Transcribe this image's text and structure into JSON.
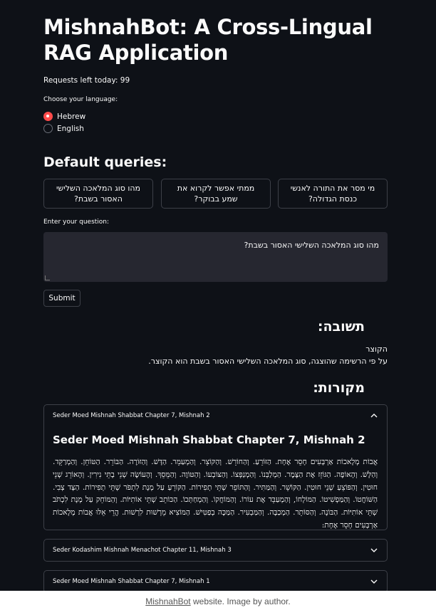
{
  "app": {
    "title": "MishnahBot: A Cross-Lingual RAG Application",
    "requests_left": "Requests left today: 99",
    "language": {
      "label": "Choose your language:",
      "options": [
        "Hebrew",
        "English"
      ],
      "selected": "Hebrew"
    },
    "default_queries": {
      "heading": "Default queries:",
      "buttons": [
        "מהו סוג המלאכה השלישי האסור בשבת?",
        "ממתי אפשר לקרוא את שמע בבוקר?",
        "מי מסר את התורה לאנשי כנסת הגדולה?"
      ]
    },
    "question": {
      "label": "Enter your question:",
      "value": "מהו סוג המלאכה השלישי האסור בשבת?"
    },
    "submit_label": "Submit",
    "answer": {
      "heading": "תשובה:",
      "line1": "הקוצר",
      "line2": "על פי הרשימה שהוצגה, סוג המלאכה השלישי האסור בשבת הוא הקוצר."
    },
    "sources": {
      "heading": "מקורות:",
      "items": [
        {
          "label": "Seder Moed Mishnah Shabbat Chapter 7, Mishnah 2",
          "expanded": true,
          "title": "Seder Moed Mishnah Shabbat Chapter 7, Mishnah 2",
          "text": "אֲבוֹת מְלָאכוֹת אַרְבָּעִים חָסֵר אֶחָת. הַזּוֹרֵעַ. וְהַחוֹרֵשׁ. וְהַקּוֹצֵר. וְהַמְעַמֵּר. הַדָּשׁ. וְהַזּוֹרֶה. הַבּוֹרֵר. הַטּוֹחֵן. וְהַמְרַקֵּד. וְהַלָּשׁ. וְהָאוֹפֶה. הַגּוֹזֵז אֶת הַצֶּמֶר. הַמְלַבְּנוֹ. וְהַמְנַפְּצוֹ. וְהַצּוֹבְעוֹ. וְהַטּוֹוֶה. וְהַמֵּסֵךְ. וְהָעוֹשֶׂה שְׁנֵי בָתֵּי נִירִין. וְהָאוֹרֵג שְׁנֵי חוּטִין. וְהַפּוֹצֵעַ שְׁנֵי חוּטִין. הַקּוֹשֵׁר. וְהַמַּתִּיר. וְהַתּוֹפֵר שְׁתֵּי תְפִירוֹת. הַקּוֹרֵעַ עַל מְנָת לִתְפֹּר שְׁתֵּי תְפִירוֹת. הַצָּד צְבִי. הַשּׁוֹחֲטוֹ. וְהַמַּפְשִׁיטוֹ. הַמּוֹלְחוֹ, וְהַמְעַבֵּד אֶת עוֹרוֹ. וְהַמּוֹחֲקוֹ. וְהַמְחַתְּכוֹ. הַכּוֹתֵב שְׁתֵּי אוֹתִיּוֹת. וְהַמּוֹחֵק עַל מְנָת לִכְתֹּב שְׁתֵּי אוֹתִיּוֹת. הַבּוֹנֶה. וְהַסּוֹתֵר. הַמְכַבֶּה. וְהַמַּבְעִיר. הַמַּכֶּה בְפַטִּישׁ. הַמּוֹצִיא מֵרְשׁוּת לִרְשׁוּת. הֲרֵי אֵלּוּ אֲבוֹת מְלָאכוֹת אַרְבָּעִים חָסֵר אֶחָת:",
          "icon": "chevron-up-icon"
        },
        {
          "label": "Seder Kodashim Mishnah Menachot Chapter 11, Mishnah 3",
          "expanded": false,
          "icon": "chevron-down-icon"
        },
        {
          "label": "Seder Moed Mishnah Shabbat Chapter 7, Mishnah 1",
          "expanded": false,
          "icon": "chevron-down-icon"
        }
      ]
    }
  },
  "caption": {
    "link": "MishnahBot",
    "rest": " website. Image by author."
  },
  "colors": {
    "background": "#0e1117",
    "accent": "#ff4b4b",
    "input_bg": "#262730",
    "border": "#3d4048",
    "text": "#fafafa"
  }
}
